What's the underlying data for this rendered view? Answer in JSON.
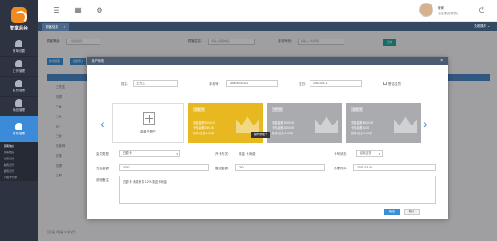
{
  "app": {
    "logo_text": "智享后台"
  },
  "sidebar": {
    "items": [
      {
        "label": "首单设置",
        "icon": "user-icon",
        "active": false
      },
      {
        "label": "工作管理",
        "icon": "user-icon",
        "active": false
      },
      {
        "label": "会员管理",
        "icon": "user-icon",
        "active": false
      },
      {
        "label": "商品管理",
        "icon": "user-icon",
        "active": false
      },
      {
        "label": "财务管理",
        "icon": "user-icon",
        "active": true
      }
    ],
    "subitems": [
      "顾客信息",
      "顾客档案",
      "充值记录",
      "消费记录",
      "储值记录",
      "疗程卡记录"
    ]
  },
  "topbar": {
    "user_name": "管家",
    "user_role": "总经理(管理员)",
    "menu_icon": "hamburger-icon",
    "grid_icon": "grid-icon",
    "settings_icon": "gear-icon",
    "power_icon": "power-icon"
  },
  "tabs": {
    "active_tab": "顾客信息",
    "close_ops": "关闭操作 ⌄"
  },
  "page": {
    "filter_label_1": "顾客等级:",
    "filter_value_1": "--全部会员--",
    "filter_label_2": "顾客姓名:",
    "filter_placeholder_2": "请输入顾客姓名",
    "filter_label_3": "手机号码:",
    "filter_placeholder_3": "请输入手机号码",
    "query_button": "查询",
    "btn_add": "新增顾客",
    "btn_import": "批量导入",
    "rows": [
      "王先生",
      "张顾",
      "王女",
      "王女",
      "富广",
      "王女",
      "张老师",
      "张茶",
      "张顾",
      "王林"
    ],
    "pager": "显示第 1 到第 10 条记录"
  },
  "modal": {
    "title": "用户修改",
    "name_label": "姓名:",
    "name_value": "王先生",
    "phone_label": "手机号:",
    "phone_value": "15904021021",
    "birth_label": "生日:",
    "birth_value": "1990-05-11",
    "checkbox_label": "是否会员",
    "add_card_label": "新增子账户",
    "cards": [
      {
        "name": "白金卡",
        "bg": "#e8b820",
        "line1": "充值金额 3000.00",
        "line2": "卡内余额 260.00",
        "line3": "折扣/优惠 1.00折"
      },
      {
        "name": "VIP卡",
        "bg": "#a9abaf",
        "line1": "充值金额 2000.00",
        "line2": "卡内余额 2000.00",
        "line3": "折扣/优惠 0.00折"
      },
      {
        "name": "钻石卡",
        "bg": "#a9abaf",
        "line1": "充值金额 8000.00",
        "line2": "卡内余额 8.00",
        "line3": "折扣/优惠 0.00折"
      }
    ],
    "tooltip": "操作添加卡",
    "member_type_label": "会员类型:",
    "member_type_value": "白银卡",
    "pay_method_label": "开卡方式:",
    "pay_method_value": "现金 卡消费",
    "status_label": "卡号状态:",
    "status_value": "启用正常",
    "recharge_label": "充值金额:",
    "recharge_value": "3000",
    "gift_label": "赠送金额:",
    "gift_value": "200",
    "open_date_label": "办理时间:",
    "open_date_value": "2016-03-09",
    "remark_label": "说明备注:",
    "remark_value": "白银卡 消费折扣 12% 赠送卡消金",
    "ok_button": "确定",
    "cancel_button": "取消"
  }
}
